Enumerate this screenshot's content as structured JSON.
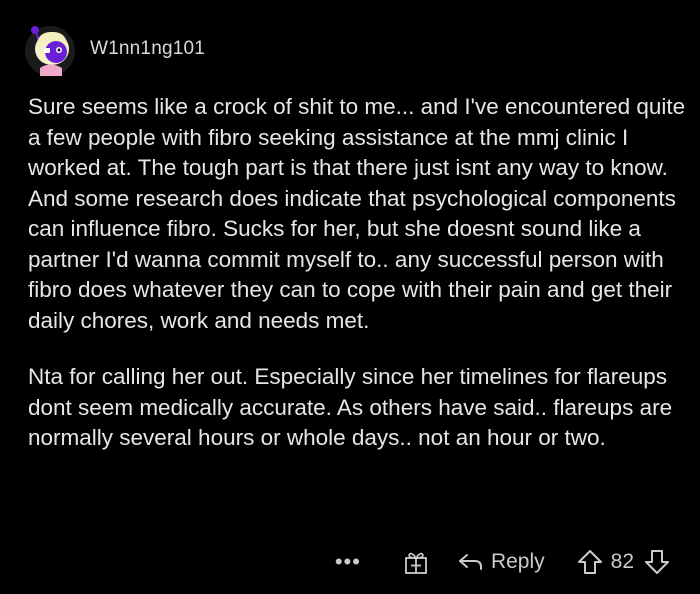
{
  "comment": {
    "username": "W1nn1ng101",
    "avatar": "avatar-purple-character",
    "paragraphs": [
      "Sure seems like a crock of shit to me... and I've encountered quite a few people with fibro seeking assistance at the mmj clinic I worked at. The tough part is that there just isnt any way to know. And some research does indicate that psychological components can influence fibro. Sucks for her, but she doesnt sound like a partner I'd wanna commit myself to.. any successful person with fibro does whatever they can to cope with their pain and get their daily chores, work and needs met.",
      "Nta for calling her out. Especially since her timelines for flareups dont seem medically accurate. As others have said.. flareups are normally several hours or whole days.. not an hour or two."
    ],
    "actions": {
      "more_label": "•••",
      "reply_label": "Reply",
      "score": "82"
    }
  },
  "colors": {
    "background": "#000000",
    "text": "#e4e6e8",
    "muted": "#c8cbce",
    "avatar_accent": "#6a1fd6"
  }
}
